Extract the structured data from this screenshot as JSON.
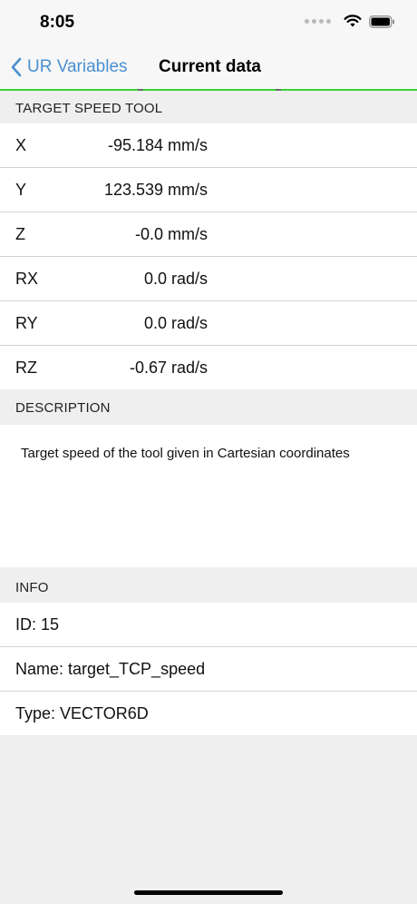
{
  "status_bar": {
    "time": "8:05"
  },
  "nav": {
    "back_label": "UR Variables",
    "title": "Current data"
  },
  "speed_section": {
    "header": "TARGET SPEED TOOL",
    "rows": [
      {
        "key": "X",
        "value": "-95.184 mm/s"
      },
      {
        "key": "Y",
        "value": "123.539 mm/s"
      },
      {
        "key": "Z",
        "value": "-0.0 mm/s"
      },
      {
        "key": "RX",
        "value": "0.0 rad/s"
      },
      {
        "key": "RY",
        "value": "0.0 rad/s"
      },
      {
        "key": "RZ",
        "value": "-0.67 rad/s"
      }
    ]
  },
  "description_section": {
    "header": "DESCRIPTION",
    "text": "Target speed of the tool given in Cartesian coordinates"
  },
  "info_section": {
    "header": "INFO",
    "items": [
      "ID: 15",
      "Name: target_TCP_speed",
      "Type: VECTOR6D"
    ]
  },
  "colors": {
    "accent": "#4a8fd0",
    "progress": "#39d23a"
  }
}
